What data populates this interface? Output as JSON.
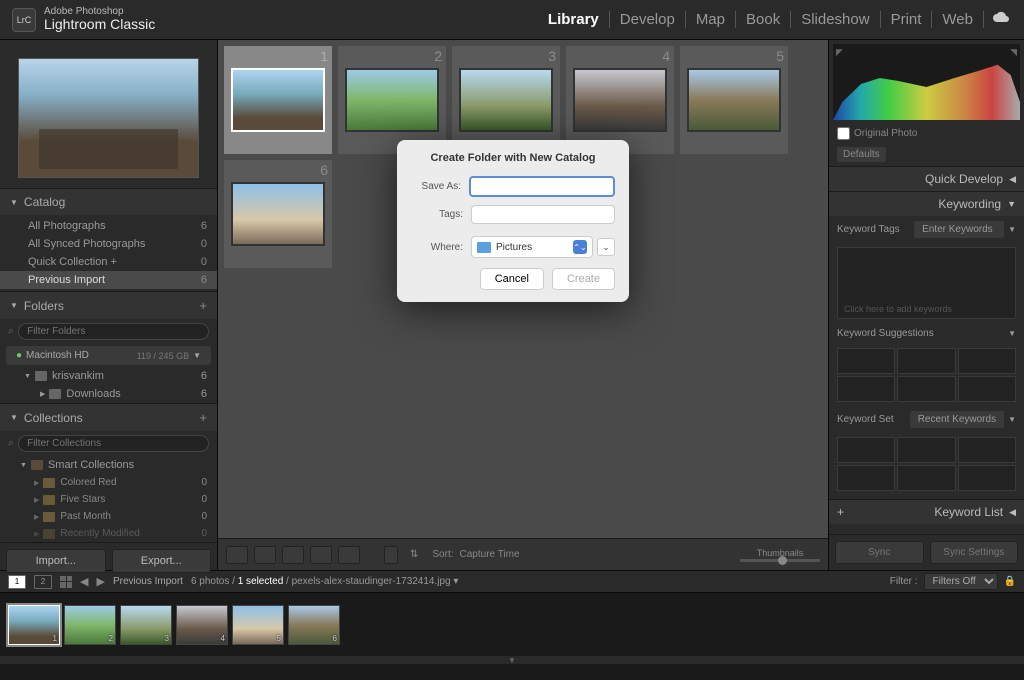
{
  "app": {
    "vendor": "Adobe Photoshop",
    "name": "Lightroom Classic",
    "logo": "LrC"
  },
  "nav": {
    "items": [
      "Library",
      "Develop",
      "Map",
      "Book",
      "Slideshow",
      "Print",
      "Web"
    ],
    "active": "Library"
  },
  "catalog": {
    "title": "Catalog",
    "rows": [
      {
        "label": "All Photographs",
        "count": "6"
      },
      {
        "label": "All Synced Photographs",
        "count": "0"
      },
      {
        "label": "Quick Collection  +",
        "count": "0"
      },
      {
        "label": "Previous Import",
        "count": "6",
        "selected": true
      }
    ]
  },
  "folders": {
    "title": "Folders",
    "search_placeholder": "Filter Folders",
    "drive": {
      "name": "Macintosh HD",
      "usage": "119 / 245 GB"
    },
    "items": [
      {
        "label": "krisvankim",
        "count": "6"
      },
      {
        "label": "Downloads",
        "count": "6",
        "indent": true
      }
    ]
  },
  "collections": {
    "title": "Collections",
    "search_placeholder": "Filter Collections",
    "smart_header": "Smart Collections",
    "items": [
      {
        "label": "Colored Red",
        "count": "0"
      },
      {
        "label": "Five Stars",
        "count": "0"
      },
      {
        "label": "Past Month",
        "count": "0"
      },
      {
        "label": "Recently Modified",
        "count": "0"
      }
    ]
  },
  "left_buttons": {
    "import": "Import...",
    "export": "Export..."
  },
  "grid_thumbs": [
    1,
    2,
    3,
    4,
    5,
    6
  ],
  "center_toolbar": {
    "sort_label": "Sort:",
    "sort_value": "Capture Time",
    "slider_label": "Thumbnails"
  },
  "histogram": {
    "original_label": "Original Photo"
  },
  "right": {
    "defaults": "Defaults",
    "quick_develop": "Quick Develop",
    "keywording": "Keywording",
    "keyword_tags_label": "Keyword Tags",
    "keyword_tags_value": "Enter Keywords",
    "keyword_box_hint": "Click here to add keywords",
    "keyword_suggestions": "Keyword Suggestions",
    "keyword_set_label": "Keyword Set",
    "keyword_set_value": "Recent Keywords",
    "keyword_list": "Keyword List",
    "sync": "Sync",
    "sync_settings": "Sync Settings"
  },
  "filmstrip_bar": {
    "source": "Previous Import",
    "count": "6 photos",
    "selected": "1 selected",
    "filename": "pexels-alex-staudinger-1732414.jpg",
    "filter_label": "Filter :",
    "filter_value": "Filters Off"
  },
  "dialog": {
    "title": "Create Folder with New Catalog",
    "save_as_label": "Save As:",
    "tags_label": "Tags:",
    "where_label": "Where:",
    "where_value": "Pictures",
    "cancel": "Cancel",
    "create": "Create"
  }
}
